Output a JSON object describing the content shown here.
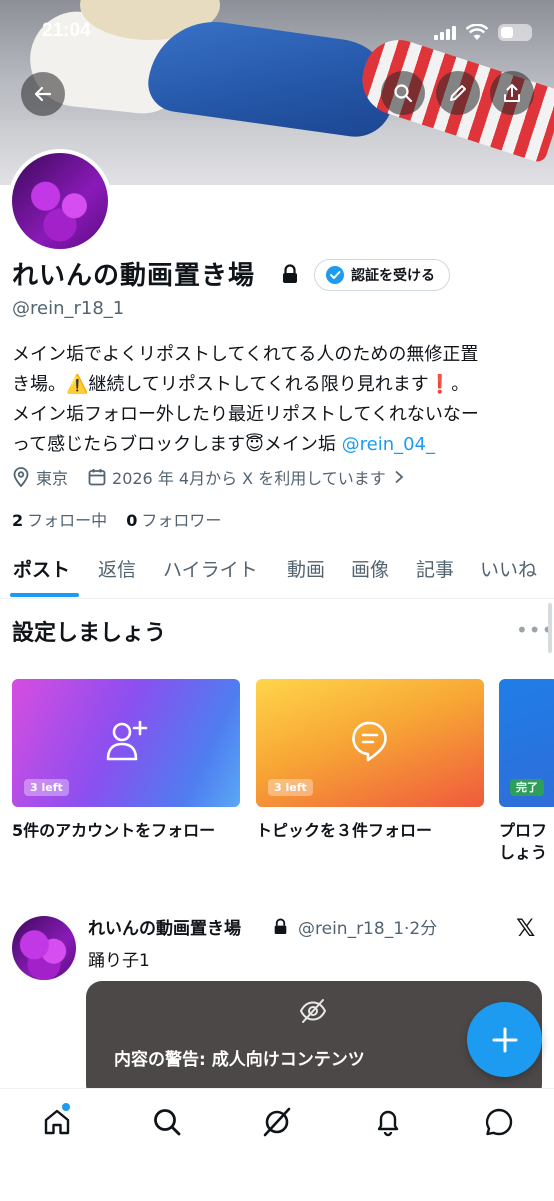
{
  "status_bar": {
    "time": "21:04"
  },
  "profile": {
    "display_name": "れいんの動画置き場",
    "verify_button": "認証を受ける",
    "handle": "@rein_r18_1",
    "bio": {
      "line1": "メイン垢でよくリポストしてくれてる人のための無修正置",
      "line2a": "き場。",
      "warning_emoji": "⚠️",
      "line2b": "継続してリポストしてくれる限り見れます",
      "exclaim_emoji": "❗",
      "line2c": "。",
      "line3": "メイン垢フォロー外したり最近リポストしてくれないなー",
      "line4a": "って感じたらブロックします",
      "line4_emoji": "😇",
      "line4b": "メイン垢",
      "mention": "@rein_04_"
    },
    "location": "東京",
    "joined": "2026 年 4月から X を利用しています",
    "following_count": "2",
    "following_label": "フォロー中",
    "followers_count": "0",
    "followers_label": "フォロワー"
  },
  "tabs": [
    "ポスト",
    "返信",
    "ハイライト",
    "動画",
    "画像",
    "記事",
    "いいね"
  ],
  "setup": {
    "title": "設定しましょう",
    "more": "•••",
    "cards": [
      {
        "badge": "3 left",
        "label": "5件のアカウントをフォロー"
      },
      {
        "badge": "3 left",
        "label": "トピックを３件フォロー"
      },
      {
        "badge": "完了",
        "label_line1": "プロフ",
        "label_line2": "しょう"
      }
    ]
  },
  "post": {
    "name": "れいんの動画置き場",
    "handle_time": "@rein_r18_1·2分",
    "text": "踊り子1",
    "x_logo": "𝕏",
    "warning": "内容の警告: 成人向けコンテンツ"
  },
  "colors": {
    "accent": "#1d9bf0",
    "text": "#0f1419",
    "secondary": "#536471"
  }
}
